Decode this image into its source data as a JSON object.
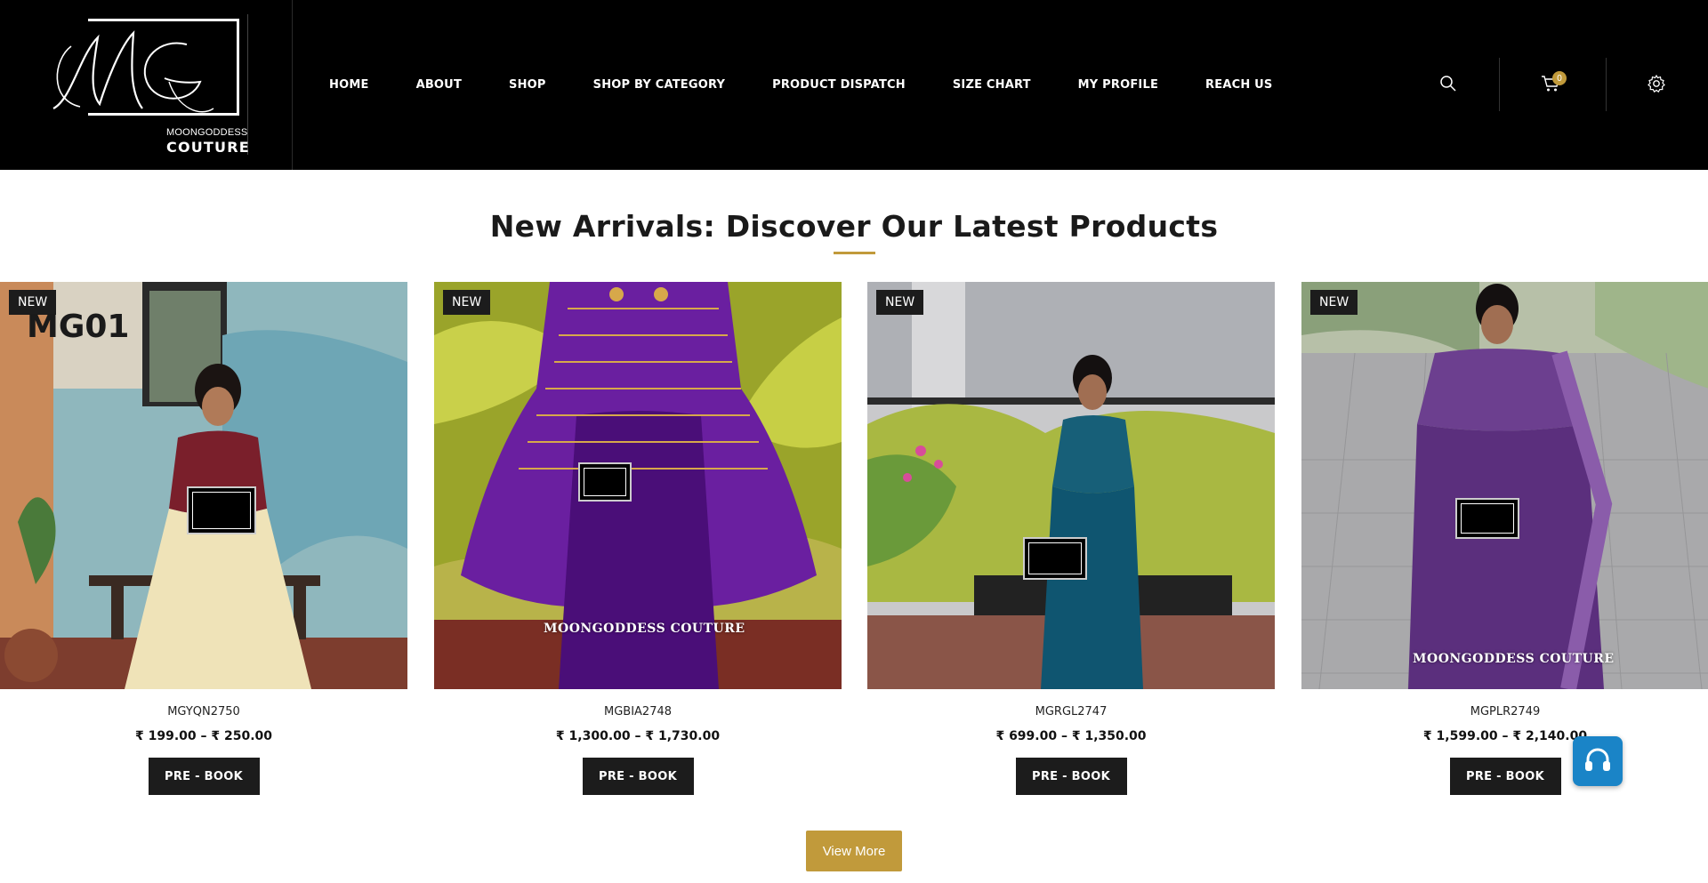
{
  "brand": {
    "line1": "MOONGODDESS",
    "line2": "COUTURE",
    "monogram": "MG"
  },
  "nav": {
    "items": [
      "HOME",
      "ABOUT",
      "SHOP",
      "SHOP BY CATEGORY",
      "PRODUCT DISPATCH",
      "SIZE CHART",
      "MY PROFILE",
      "REACH US"
    ]
  },
  "header": {
    "icons": [
      "search-icon",
      "cart-icon",
      "gear-icon"
    ],
    "cart_count": "0"
  },
  "section": {
    "title": "New Arrivals: Discover Our Latest Products"
  },
  "products": [
    {
      "badge": "NEW",
      "overlay": "MG01",
      "name": "MGYQN2750",
      "price": "₹ 199.00 – ₹ 250.00",
      "button": "PRE - BOOK",
      "watermark_text": ""
    },
    {
      "badge": "NEW",
      "overlay": "",
      "name": "MGBIA2748",
      "price": "₹ 1,300.00 – ₹ 1,730.00",
      "button": "PRE - BOOK",
      "watermark_text": "MOONGODDESS COUTURE"
    },
    {
      "badge": "NEW",
      "overlay": "",
      "name": "MGRGL2747",
      "price": "₹ 699.00 – ₹ 1,350.00",
      "button": "PRE - BOOK",
      "watermark_text": ""
    },
    {
      "badge": "NEW",
      "overlay": "",
      "name": "MGPLR2749",
      "price": "₹ 1,599.00 – ₹ 2,140.00",
      "button": "PRE - BOOK",
      "watermark_text": "MOONGODDESS COUTURE"
    }
  ],
  "view_more": "View More",
  "colors": {
    "accent": "#c19a3b",
    "header_bg": "#000000",
    "button_dark": "#1c1c1c",
    "support": "#1a84c7"
  }
}
